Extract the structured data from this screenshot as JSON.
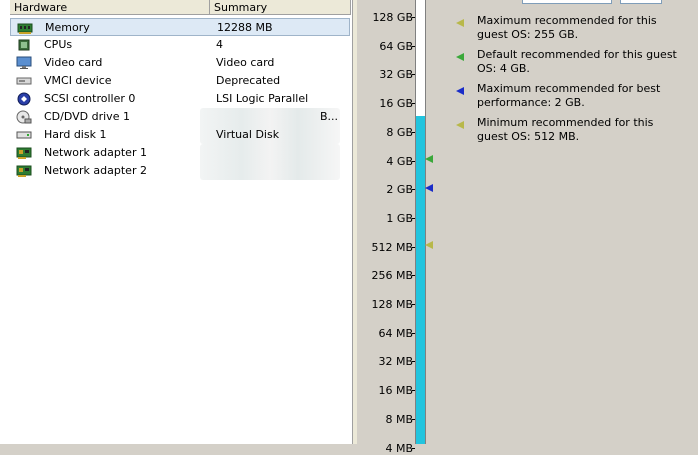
{
  "hardware_list": {
    "headers": {
      "hardware": "Hardware",
      "summary": "Summary"
    },
    "rows": [
      {
        "name": "Memory",
        "summary": "12288 MB",
        "icon": "memory-icon",
        "selected": true
      },
      {
        "name": "CPUs",
        "summary": "4",
        "icon": "cpu-icon"
      },
      {
        "name": "Video card",
        "summary": "Video card",
        "icon": "monitor-icon"
      },
      {
        "name": "VMCI device",
        "summary": "Deprecated",
        "icon": "device-icon"
      },
      {
        "name": "SCSI controller 0",
        "summary": "LSI Logic Parallel",
        "icon": "scsi-icon"
      },
      {
        "name": "CD/DVD drive 1",
        "summary": "",
        "extra": "B...",
        "icon": "cd-drive-icon"
      },
      {
        "name": "Hard disk 1",
        "summary": "Virtual Disk",
        "icon": "hard-disk-icon"
      },
      {
        "name": "Network adapter 1",
        "summary": "",
        "icon": "network-card-icon"
      },
      {
        "name": "Network adapter 2",
        "summary": "",
        "icon": "network-card-icon"
      }
    ]
  },
  "memory_scale": {
    "ticks": [
      "128 GB",
      "64 GB",
      "32 GB",
      "16 GB",
      "8 GB",
      "4 GB",
      "2 GB",
      "1 GB",
      "512 MB",
      "256 MB",
      "128 MB",
      "64 MB",
      "32 MB",
      "16 MB",
      "8 MB",
      "4 MB"
    ],
    "current_value": "12288 MB"
  },
  "legend": [
    {
      "text": "Maximum recommended for this guest OS: 255 GB.",
      "icon": "yellow-triangle-icon"
    },
    {
      "text": "Default recommended for this guest OS: 4 GB.",
      "icon": "green-triangle-icon"
    },
    {
      "text": "Maximum recommended for best performance: 2 GB.",
      "icon": "blue-triangle-icon"
    },
    {
      "text": "Minimum recommended for this guest OS: 512 MB.",
      "icon": "yellow-triangle-icon"
    }
  ],
  "colors": {
    "scale_fill": "#22c4de",
    "selection": "#dde9f5",
    "marker_yellow": "#b8b84a",
    "marker_green": "#3aa83a",
    "marker_blue": "#1a2cc8"
  }
}
